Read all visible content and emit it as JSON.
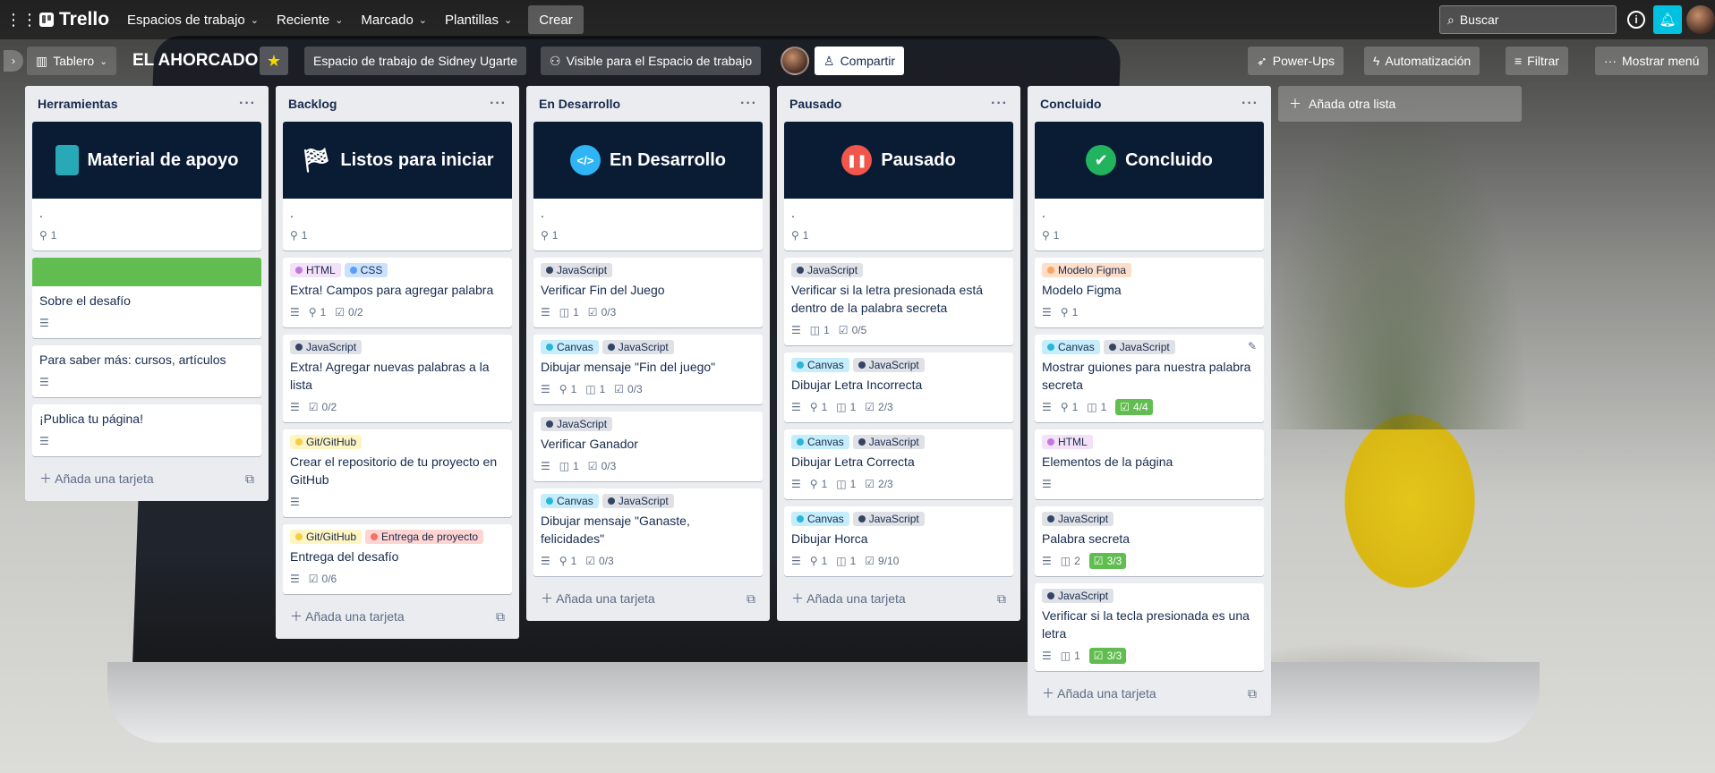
{
  "topbar": {
    "logo": "Trello",
    "nav": [
      "Espacios de trabajo",
      "Reciente",
      "Marcado",
      "Plantillas"
    ],
    "create": "Crear",
    "search_placeholder": "Buscar"
  },
  "board": {
    "title": "EL AHORCADO",
    "view": "Tablero",
    "workspace": "Espacio de trabajo de Sidney Ugarte",
    "visibility": "Visible para el Espacio de trabajo",
    "share": "Compartir",
    "powerups": "Power-Ups",
    "automation": "Automatización",
    "filter": "Filtrar",
    "menu": "Mostrar menú",
    "add_list": "Añada otra lista"
  },
  "add_card": "Añada una tarjeta",
  "colors": {
    "green": "#61bd4f",
    "dark_cover": "#0a1b34",
    "bell": "#00c2e0"
  },
  "lists": [
    {
      "name": "Herramientas",
      "cover_title": "Material de apoyo",
      "cover_icon": "notebook-icon",
      "cover_dot": ".",
      "cover_attach": "1",
      "cards": [
        {
          "title": "Sobre el desafío"
        },
        {
          "title": "Para saber más: cursos, artículos"
        },
        {
          "title": "¡Publica tu página!"
        }
      ]
    },
    {
      "name": "Backlog",
      "cover_title": "Listos para iniciar",
      "cover_icon": "checkered-flag-icon",
      "cover_dot": ".",
      "cover_attach": "1",
      "cards": [
        {
          "labels": [
            "HTML",
            "CSS"
          ],
          "title": "Extra! Campos para agregar palabra",
          "attach": "1",
          "check": "0/2"
        },
        {
          "labels": [
            "JavaScript"
          ],
          "title": "Extra! Agregar nuevas palabras a la lista",
          "check": "0/2"
        },
        {
          "labels": [
            "Git/GitHub"
          ],
          "title": "Crear el repositorio de tu proyecto en GitHub"
        },
        {
          "labels": [
            "Git/GitHub",
            "Entrega de proyecto"
          ],
          "title": "Entrega del desafío",
          "check": "0/6"
        }
      ]
    },
    {
      "name": "En Desarrollo",
      "cover_title": "En Desarrollo",
      "cover_icon": "code-icon",
      "cover_dot": ".",
      "cover_attach": "1",
      "cards": [
        {
          "labels": [
            "JavaScript"
          ],
          "title": "Verificar Fin del Juego",
          "trello": "1",
          "check": "0/3"
        },
        {
          "labels": [
            "Canvas",
            "JavaScript"
          ],
          "title": "Dibujar mensaje \"Fin del juego\"",
          "attach": "1",
          "trello": "1",
          "check": "0/3"
        },
        {
          "labels": [
            "JavaScript"
          ],
          "title": "Verificar Ganador",
          "trello": "1",
          "check": "0/3"
        },
        {
          "labels": [
            "Canvas",
            "JavaScript"
          ],
          "title": "Dibujar mensaje \"Ganaste, felicidades\"",
          "attach": "1",
          "check": "0/3"
        }
      ]
    },
    {
      "name": "Pausado",
      "cover_title": "Pausado",
      "cover_icon": "pause-icon",
      "cover_dot": ".",
      "cover_attach": "1",
      "cards": [
        {
          "labels": [
            "JavaScript"
          ],
          "title": "Verificar si la letra presionada está dentro de la palabra secreta",
          "trello": "1",
          "check": "0/5"
        },
        {
          "labels": [
            "Canvas",
            "JavaScript"
          ],
          "title": "Dibujar Letra Incorrecta",
          "attach": "1",
          "trello": "1",
          "check": "2/3"
        },
        {
          "labels": [
            "Canvas",
            "JavaScript"
          ],
          "title": "Dibujar Letra Correcta",
          "attach": "1",
          "trello": "1",
          "check": "2/3"
        },
        {
          "labels": [
            "Canvas",
            "JavaScript"
          ],
          "title": "Dibujar Horca",
          "attach": "1",
          "trello": "1",
          "check": "9/10"
        }
      ]
    },
    {
      "name": "Concluido",
      "cover_title": "Concluido",
      "cover_icon": "check-circle-icon",
      "cover_dot": ".",
      "cover_attach": "1",
      "cards": [
        {
          "labels": [
            "Modelo Figma"
          ],
          "title": "Modelo Figma",
          "attach": "1"
        },
        {
          "labels": [
            "Canvas",
            "JavaScript"
          ],
          "title": "Mostrar guiones para nuestra palabra secreta",
          "attach": "1",
          "trello": "1",
          "done": "4/4"
        },
        {
          "labels": [
            "HTML"
          ],
          "title": "Elementos de la página"
        },
        {
          "labels": [
            "JavaScript"
          ],
          "title": "Palabra secreta",
          "trello": "2",
          "done": "3/3"
        },
        {
          "labels": [
            "JavaScript"
          ],
          "title": "Verificar si la tecla presionada es una letra",
          "trello": "1",
          "done": "3/3"
        }
      ]
    }
  ]
}
